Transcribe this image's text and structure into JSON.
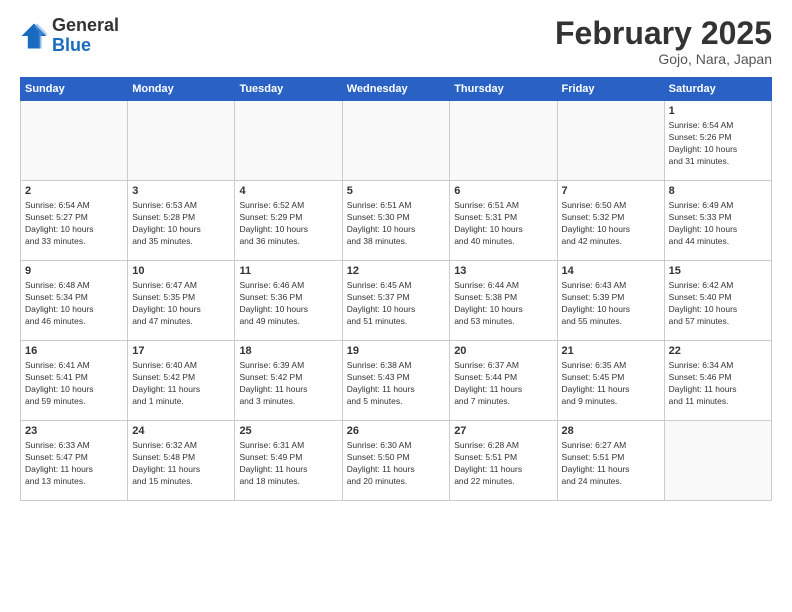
{
  "logo": {
    "general": "General",
    "blue": "Blue"
  },
  "header": {
    "month": "February 2025",
    "location": "Gojo, Nara, Japan"
  },
  "days_of_week": [
    "Sunday",
    "Monday",
    "Tuesday",
    "Wednesday",
    "Thursday",
    "Friday",
    "Saturday"
  ],
  "weeks": [
    [
      {
        "day": "",
        "info": ""
      },
      {
        "day": "",
        "info": ""
      },
      {
        "day": "",
        "info": ""
      },
      {
        "day": "",
        "info": ""
      },
      {
        "day": "",
        "info": ""
      },
      {
        "day": "",
        "info": ""
      },
      {
        "day": "1",
        "info": "Sunrise: 6:54 AM\nSunset: 5:26 PM\nDaylight: 10 hours\nand 31 minutes."
      }
    ],
    [
      {
        "day": "2",
        "info": "Sunrise: 6:54 AM\nSunset: 5:27 PM\nDaylight: 10 hours\nand 33 minutes."
      },
      {
        "day": "3",
        "info": "Sunrise: 6:53 AM\nSunset: 5:28 PM\nDaylight: 10 hours\nand 35 minutes."
      },
      {
        "day": "4",
        "info": "Sunrise: 6:52 AM\nSunset: 5:29 PM\nDaylight: 10 hours\nand 36 minutes."
      },
      {
        "day": "5",
        "info": "Sunrise: 6:51 AM\nSunset: 5:30 PM\nDaylight: 10 hours\nand 38 minutes."
      },
      {
        "day": "6",
        "info": "Sunrise: 6:51 AM\nSunset: 5:31 PM\nDaylight: 10 hours\nand 40 minutes."
      },
      {
        "day": "7",
        "info": "Sunrise: 6:50 AM\nSunset: 5:32 PM\nDaylight: 10 hours\nand 42 minutes."
      },
      {
        "day": "8",
        "info": "Sunrise: 6:49 AM\nSunset: 5:33 PM\nDaylight: 10 hours\nand 44 minutes."
      }
    ],
    [
      {
        "day": "9",
        "info": "Sunrise: 6:48 AM\nSunset: 5:34 PM\nDaylight: 10 hours\nand 46 minutes."
      },
      {
        "day": "10",
        "info": "Sunrise: 6:47 AM\nSunset: 5:35 PM\nDaylight: 10 hours\nand 47 minutes."
      },
      {
        "day": "11",
        "info": "Sunrise: 6:46 AM\nSunset: 5:36 PM\nDaylight: 10 hours\nand 49 minutes."
      },
      {
        "day": "12",
        "info": "Sunrise: 6:45 AM\nSunset: 5:37 PM\nDaylight: 10 hours\nand 51 minutes."
      },
      {
        "day": "13",
        "info": "Sunrise: 6:44 AM\nSunset: 5:38 PM\nDaylight: 10 hours\nand 53 minutes."
      },
      {
        "day": "14",
        "info": "Sunrise: 6:43 AM\nSunset: 5:39 PM\nDaylight: 10 hours\nand 55 minutes."
      },
      {
        "day": "15",
        "info": "Sunrise: 6:42 AM\nSunset: 5:40 PM\nDaylight: 10 hours\nand 57 minutes."
      }
    ],
    [
      {
        "day": "16",
        "info": "Sunrise: 6:41 AM\nSunset: 5:41 PM\nDaylight: 10 hours\nand 59 minutes."
      },
      {
        "day": "17",
        "info": "Sunrise: 6:40 AM\nSunset: 5:42 PM\nDaylight: 11 hours\nand 1 minute."
      },
      {
        "day": "18",
        "info": "Sunrise: 6:39 AM\nSunset: 5:42 PM\nDaylight: 11 hours\nand 3 minutes."
      },
      {
        "day": "19",
        "info": "Sunrise: 6:38 AM\nSunset: 5:43 PM\nDaylight: 11 hours\nand 5 minutes."
      },
      {
        "day": "20",
        "info": "Sunrise: 6:37 AM\nSunset: 5:44 PM\nDaylight: 11 hours\nand 7 minutes."
      },
      {
        "day": "21",
        "info": "Sunrise: 6:35 AM\nSunset: 5:45 PM\nDaylight: 11 hours\nand 9 minutes."
      },
      {
        "day": "22",
        "info": "Sunrise: 6:34 AM\nSunset: 5:46 PM\nDaylight: 11 hours\nand 11 minutes."
      }
    ],
    [
      {
        "day": "23",
        "info": "Sunrise: 6:33 AM\nSunset: 5:47 PM\nDaylight: 11 hours\nand 13 minutes."
      },
      {
        "day": "24",
        "info": "Sunrise: 6:32 AM\nSunset: 5:48 PM\nDaylight: 11 hours\nand 15 minutes."
      },
      {
        "day": "25",
        "info": "Sunrise: 6:31 AM\nSunset: 5:49 PM\nDaylight: 11 hours\nand 18 minutes."
      },
      {
        "day": "26",
        "info": "Sunrise: 6:30 AM\nSunset: 5:50 PM\nDaylight: 11 hours\nand 20 minutes."
      },
      {
        "day": "27",
        "info": "Sunrise: 6:28 AM\nSunset: 5:51 PM\nDaylight: 11 hours\nand 22 minutes."
      },
      {
        "day": "28",
        "info": "Sunrise: 6:27 AM\nSunset: 5:51 PM\nDaylight: 11 hours\nand 24 minutes."
      },
      {
        "day": "",
        "info": ""
      }
    ]
  ]
}
